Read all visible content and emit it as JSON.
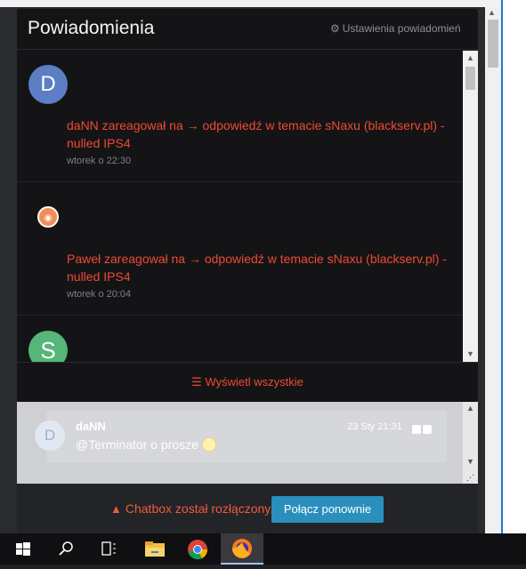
{
  "popover": {
    "title": "Powiadomienia",
    "settings_label": "Ustawienia powiadomień",
    "settings_icon": "gear-icon",
    "view_all_label": "Wyświetl wszystkie",
    "view_all_icon": "list-icon",
    "notifications": [
      {
        "avatar_letter": "D",
        "avatar_color": "#5b7ec5",
        "text": "daNN zareagował na → odpowiedź w temacie sNaxu (blackserv.pl) - nulled IPS4",
        "time": "wtorek o 22:30"
      },
      {
        "avatar_letter": "",
        "avatar_color": "#f08e59",
        "text": "Paweł zareagował na → odpowiedź w temacie sNaxu (blackserv.pl) - nulled IPS4",
        "time": "wtorek o 20:04"
      },
      {
        "avatar_letter": "S",
        "avatar_color": "#56b679",
        "text": "",
        "time": ""
      }
    ]
  },
  "chat": {
    "avatar_letter": "D",
    "author": "daNN",
    "message": "@Terminator o prosze",
    "time": "23 Sty 21:31",
    "disconnect_text": "Chatbox został rozłączony.",
    "reconnect_label": "Połącz ponownie"
  },
  "taskbar": {
    "items": [
      "windows-start",
      "search",
      "task-view",
      "file-explorer",
      "chrome",
      "firefox"
    ]
  },
  "colors": {
    "accent": "#ef4a2f",
    "button": "#2b8fbd",
    "popover_bg": "#141417"
  }
}
